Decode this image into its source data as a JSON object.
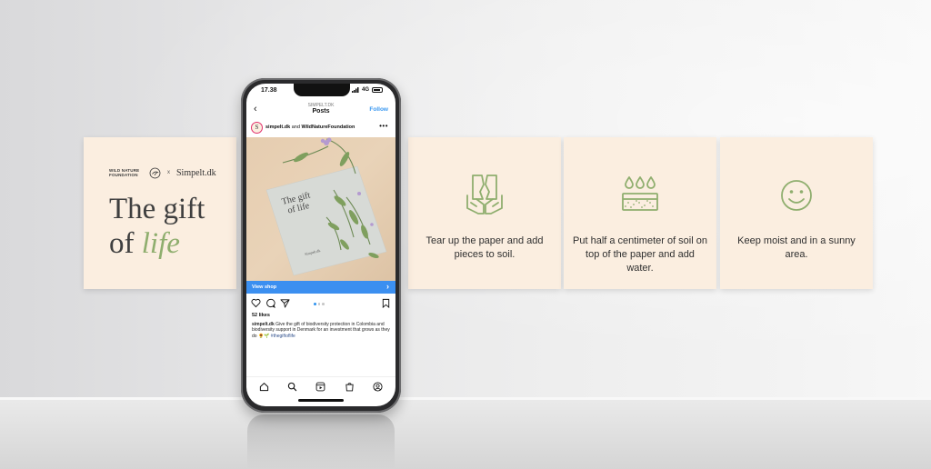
{
  "cards": {
    "brand": {
      "partner_logo": "WILD NATURE FOUNDATION",
      "separator": "x",
      "brand_logo": "Simpelt.dk",
      "title_line1": "The gift",
      "title_of": "of ",
      "title_life": "life"
    },
    "steps": [
      {
        "icon": "tear-paper-hands-icon",
        "text": "Tear up the paper and add pieces to soil."
      },
      {
        "icon": "soil-water-drops-icon",
        "text": "Put half a centimeter of soil on top of the paper and add water."
      },
      {
        "icon": "smiley-face-icon",
        "text": "Keep moist and in a sunny area."
      }
    ],
    "card_color": "#fbeee0",
    "accent_green": "#8fae6e"
  },
  "phone": {
    "status": {
      "time": "17.38",
      "network": "4G"
    },
    "header": {
      "account": "SIMPELT.DK",
      "title": "Posts",
      "follow_label": "Follow"
    },
    "post": {
      "avatar_letter": "S",
      "user": "simpelt.dk",
      "and": " and ",
      "collab": "WildNatureFoundation",
      "image_card_title_line1": "The gift",
      "image_card_title_line2": "of life",
      "image_card_brand": "Simpelt.dk",
      "shop_label": "View shop",
      "likes": "52 likes",
      "caption_user": "simpelt.dk",
      "caption_text": " Give the gift of biodiversity protection in Colombia and biodiversity support in Denmark for an investment that grows as they do 🌻🌱 ",
      "caption_tag": "#thegiftoflife",
      "carousel_index": 1,
      "carousel_count": 3
    },
    "accent_blue": "#3897f0"
  }
}
